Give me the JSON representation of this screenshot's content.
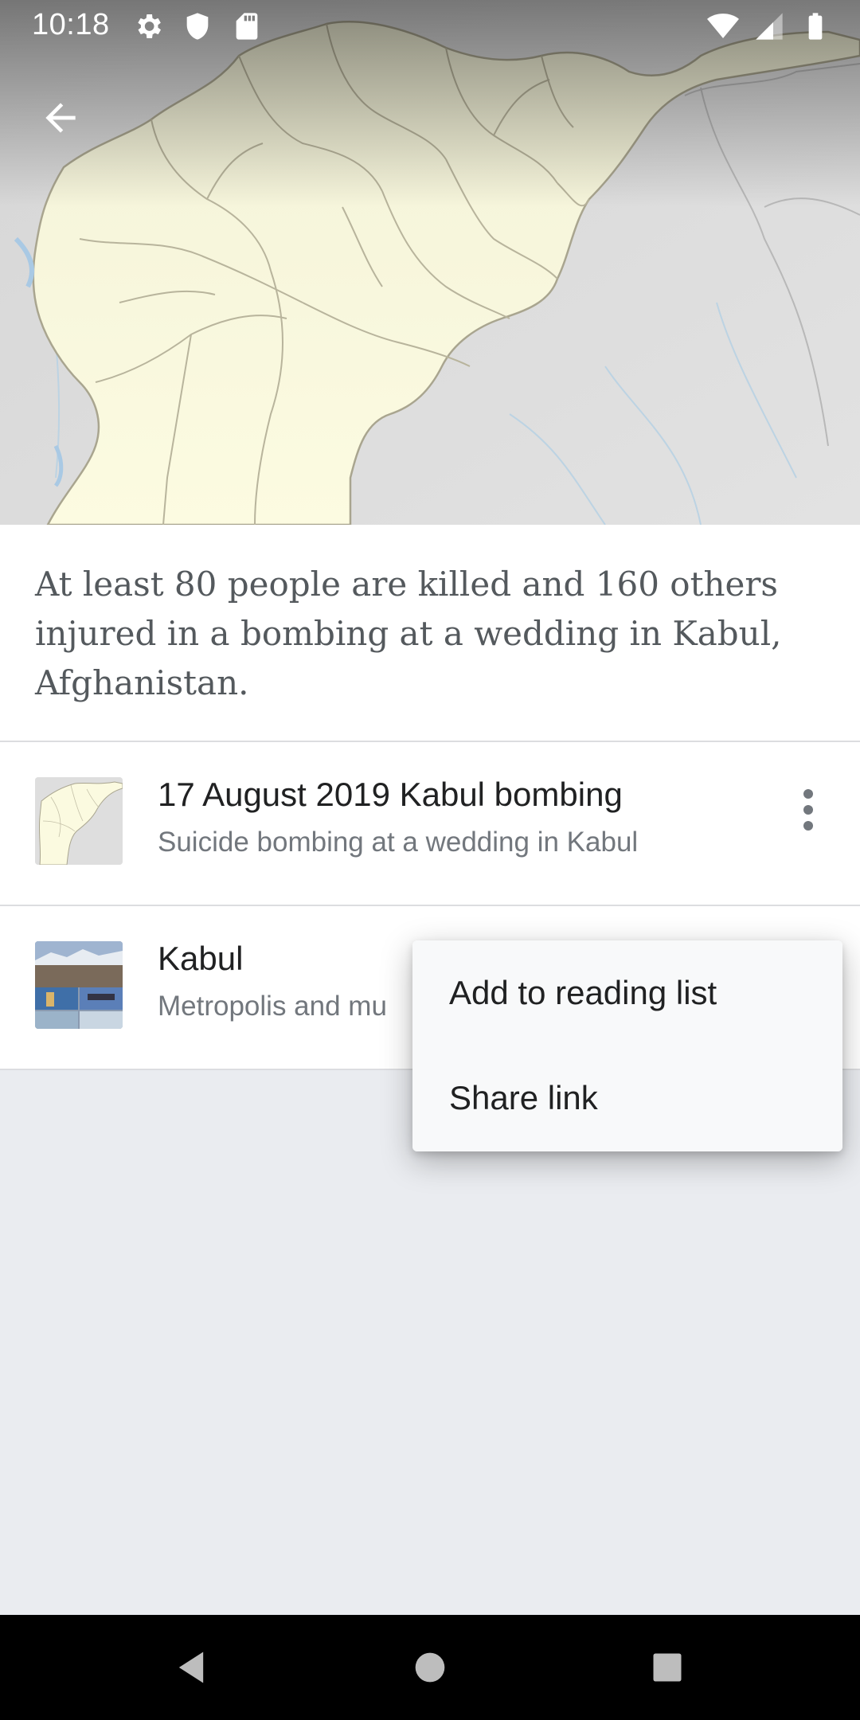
{
  "status_bar": {
    "time": "10:18",
    "left_icons": [
      "settings-icon",
      "shield-icon",
      "sd-card-icon"
    ],
    "right_icons": [
      "wifi-icon",
      "signal-icon",
      "battery-icon"
    ]
  },
  "header": {
    "back_icon": "arrow-left-icon",
    "image": "map-of-afghanistan"
  },
  "summary": {
    "text": "At least 80 people are killed and 160 others injured in a bombing at a wedding in Kabul, Afghanistan."
  },
  "articles": [
    {
      "title": "17 August 2019 Kabul bombing",
      "description": "Suicide bombing at a wedding in Kabul",
      "thumbnail": "afghanistan-map-thumbnail",
      "has_overflow_menu": true
    },
    {
      "title": "Kabul",
      "description": "Metropolis and mu",
      "thumbnail": "kabul-collage-thumbnail"
    }
  ],
  "popup_menu": {
    "items": [
      "Add to reading list",
      "Share link"
    ]
  },
  "nav_bar": {
    "buttons": [
      "back-triangle-icon",
      "home-circle-icon",
      "recents-square-icon"
    ]
  },
  "colors": {
    "summary_text": "#54595d",
    "title_text": "#202122",
    "description_text": "#72777d",
    "background": "#eaecf0",
    "menu_background": "#f8f9fa",
    "map_land": "#fbfae0",
    "map_border": "#a9a58f"
  }
}
